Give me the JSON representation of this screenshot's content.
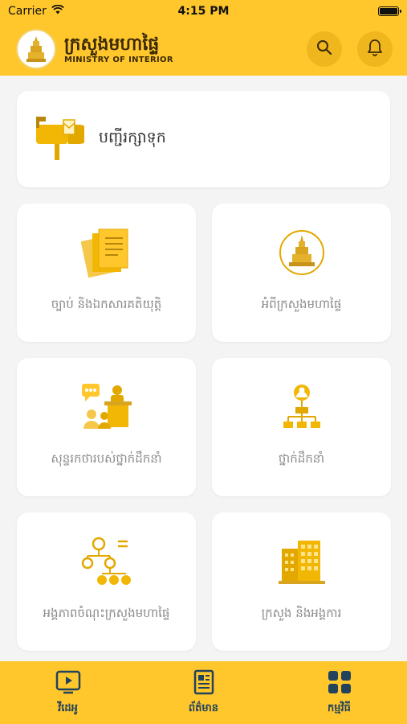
{
  "status_bar": {
    "carrier": "Carrier",
    "time": "4:15 PM"
  },
  "header": {
    "title_kh": "ក្រសួងមហាផ្ទៃ",
    "title_en": "MINISTRY OF INTERIOR",
    "search_icon": "search-icon",
    "bell_icon": "bell-icon"
  },
  "main": {
    "mailbox_card": {
      "label": "បញ្ជីរក្សាទុក",
      "icon": "mailbox-icon"
    },
    "tiles": [
      {
        "label": "ច្បាប់ និងឯកសារគតិយុត្តិ",
        "icon": "documents-icon"
      },
      {
        "label": "អំពីក្រសួងមហាផ្ទៃ",
        "icon": "ministry-emblem-icon"
      },
      {
        "label": "សុន្ទរកថារបស់ថ្នាក់ដឹកនាំ",
        "icon": "speech-podium-icon"
      },
      {
        "label": "ថ្នាក់ដឹកនាំ",
        "icon": "org-chart-person-icon"
      },
      {
        "label": "អង្គភាពចំណុះក្រសួងមហាផ្ទៃ",
        "icon": "org-structure-icon"
      },
      {
        "label": "ក្រសួង និងអង្គការ",
        "icon": "building-icon"
      }
    ]
  },
  "tabbar": {
    "tabs": [
      {
        "label": "វីដេអូ",
        "icon": "video-play-icon"
      },
      {
        "label": "ព័ត៌មាន",
        "icon": "newspaper-icon"
      },
      {
        "label": "កម្មវិធី",
        "icon": "apps-grid-icon"
      }
    ]
  },
  "colors": {
    "primary_yellow": "#FFC72C",
    "icon_gold": "#F2B705",
    "tab_icon": "#23425C",
    "label_gray": "#8A8A8A"
  }
}
